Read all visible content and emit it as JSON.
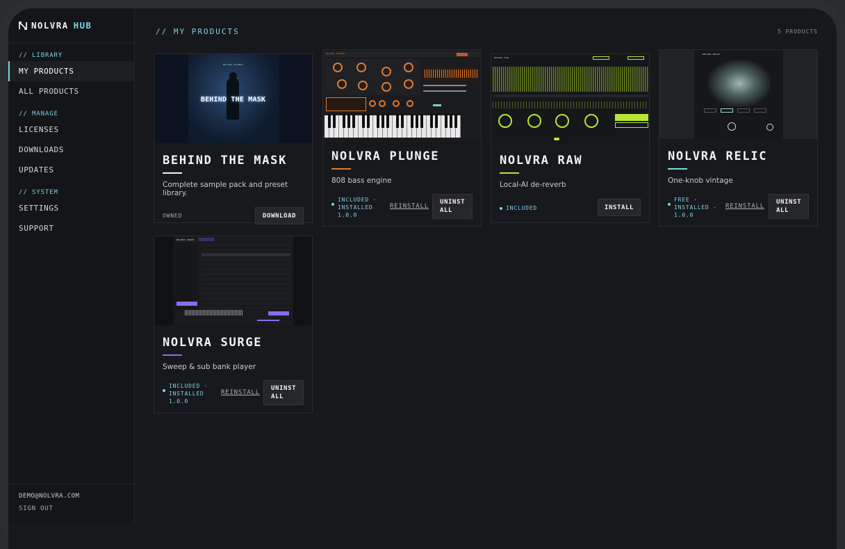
{
  "brand": {
    "name": "NOLVRA",
    "hub": "HUB"
  },
  "sidebar": {
    "sections": [
      {
        "label": "// LIBRARY",
        "items": [
          "MY PRODUCTS",
          "ALL PRODUCTS"
        ]
      },
      {
        "label": "// MANAGE",
        "items": [
          "LICENSES",
          "DOWNLOADS",
          "UPDATES"
        ]
      },
      {
        "label": "// SYSTEM",
        "items": [
          "SETTINGS",
          "SUPPORT"
        ]
      }
    ],
    "active_item": "MY PRODUCTS",
    "footer": {
      "email": "DEMO@NOLVRA.COM",
      "signout": "SIGN OUT"
    }
  },
  "main": {
    "title": "// MY PRODUCTS",
    "count": "5 PRODUCTS"
  },
  "products": [
    {
      "title": "BEHIND THE MASK",
      "description": "Complete sample pack and preset library.",
      "status_text": "OWNED",
      "primary_action": "DOWNLOAD",
      "accent_color": "#f2f3f5",
      "cover_text": "BEHIND THE MASK",
      "cover_small": "NOLVRA PLUNGE"
    },
    {
      "title": "NOLVRA PLUNGE",
      "description": "808 bass engine",
      "status_line1": "INCLUDED ·",
      "status_line2": "INSTALLED",
      "status_line3": "1.0.0",
      "secondary_action": "REINSTALL",
      "primary_action_l1": "UNINST",
      "primary_action_l2": "ALL",
      "accent_color": "#e07a2e",
      "plugin_label": "NOLVRA PLUNGE"
    },
    {
      "title": "NOLVRA RAW",
      "description": "Local-AI de-reverb",
      "status_text": "INCLUDED",
      "primary_action": "INSTALL",
      "accent_color": "#b9e63a",
      "plugin_label": "NOLVRA RAW"
    },
    {
      "title": "NOLVRA RELIC",
      "description": "One-knob vintage",
      "status_line1": "FREE ·",
      "status_line2": "INSTALLED ·",
      "status_line3": "1.0.0",
      "secondary_action": "REINSTALL",
      "primary_action_l1": "UNINST",
      "primary_action_l2": "ALL",
      "accent_color": "#7ee0cf",
      "plugin_label": "NOLVRA RELIC"
    },
    {
      "title": "NOLVRA SURGE",
      "description": "Sweep & sub bank player",
      "status_line1": "INCLUDED ·",
      "status_line2": "INSTALLED",
      "status_line3": "1.0.0",
      "secondary_action": "REINSTALL",
      "primary_action_l1": "UNINST",
      "primary_action_l2": "ALL",
      "accent_color": "#8a6cf0",
      "plugin_label": "NOLVRA SURGE"
    }
  ],
  "icons": {
    "logo": "nolvra-logo-icon",
    "status_dot": "status-dot-icon"
  },
  "colors": {
    "accent": "#79d3e6",
    "background": "#17181b",
    "sidebar": "#141518"
  }
}
